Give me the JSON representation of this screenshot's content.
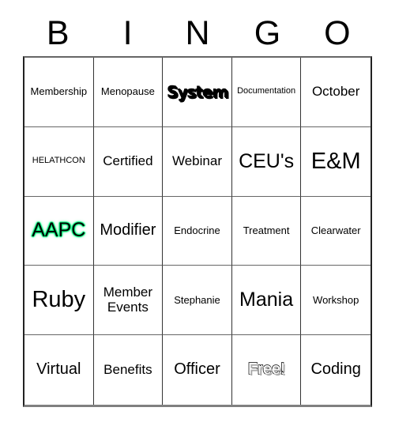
{
  "card": {
    "header_letters": [
      "B",
      "I",
      "N",
      "G",
      "O"
    ],
    "rows": [
      [
        {
          "text": "Membership",
          "size": "fs-s",
          "style": "plain"
        },
        {
          "text": "Menopause",
          "size": "fs-s",
          "style": "plain"
        },
        {
          "text": "System",
          "size": "fs-l",
          "style": "shadow"
        },
        {
          "text": "Documentation",
          "size": "fs-xs",
          "style": "plain"
        },
        {
          "text": "October",
          "size": "fs-m",
          "style": "plain"
        }
      ],
      [
        {
          "text": "HELATHCON",
          "size": "fs-xs",
          "style": "plain"
        },
        {
          "text": "Certified",
          "size": "fs-m",
          "style": "plain"
        },
        {
          "text": "Webinar",
          "size": "fs-m",
          "style": "plain"
        },
        {
          "text": "CEU's",
          "size": "fs-xl",
          "style": "plain"
        },
        {
          "text": "E&M",
          "size": "fs-xxl",
          "style": "plain"
        }
      ],
      [
        {
          "text": "AAPC",
          "size": "fs-xl",
          "style": "glow"
        },
        {
          "text": "Modifier",
          "size": "fs-l",
          "style": "plain"
        },
        {
          "text": "Endocrine",
          "size": "fs-s",
          "style": "plain"
        },
        {
          "text": "Treatment",
          "size": "fs-s",
          "style": "plain"
        },
        {
          "text": "Clearwater",
          "size": "fs-s",
          "style": "plain"
        }
      ],
      [
        {
          "text": "Ruby",
          "size": "fs-xxl",
          "style": "plain"
        },
        {
          "text": "Member\nEvents",
          "size": "fs-m",
          "style": "plain"
        },
        {
          "text": "Stephanie",
          "size": "fs-s",
          "style": "plain"
        },
        {
          "text": "Mania",
          "size": "fs-xl",
          "style": "plain"
        },
        {
          "text": "Workshop",
          "size": "fs-s",
          "style": "plain"
        }
      ],
      [
        {
          "text": "Virtual",
          "size": "fs-l",
          "style": "plain"
        },
        {
          "text": "Benefits",
          "size": "fs-m",
          "style": "plain"
        },
        {
          "text": "Officer",
          "size": "fs-l",
          "style": "plain"
        },
        {
          "text": "Free!",
          "size": "fs-l",
          "style": "outline"
        },
        {
          "text": "Coding",
          "size": "fs-l",
          "style": "plain"
        }
      ]
    ]
  },
  "colors": {
    "background": "#ffffff",
    "text": "#000000",
    "grid_line": "#333333",
    "grid_bottom": "#808080",
    "aapc_glow": "#00f27a"
  }
}
